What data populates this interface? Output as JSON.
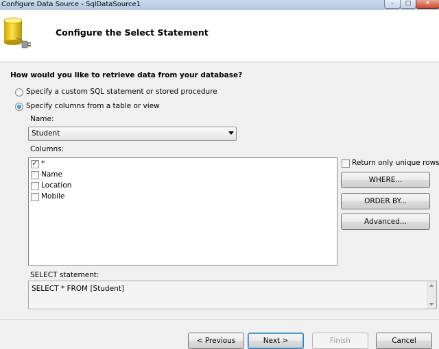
{
  "window": {
    "title": "Configure Data Source - SqlDataSource1",
    "min_glyph": "–",
    "max_glyph": "□",
    "close_glyph": "✕"
  },
  "header": {
    "title": "Configure the Select Statement",
    "icon": "database-plug-icon"
  },
  "question": "How would you like to retrieve data from your database?",
  "options": [
    {
      "label": "Specify a custom SQL statement or stored procedure",
      "selected": false
    },
    {
      "label": "Specify columns from a table or view",
      "selected": true
    }
  ],
  "name_field": {
    "label": "Name:",
    "value": "Student"
  },
  "columns": {
    "label": "Columns:",
    "items": [
      {
        "label": "*",
        "checked": true
      },
      {
        "label": "Name",
        "checked": false
      },
      {
        "label": "Location",
        "checked": false
      },
      {
        "label": "Mobile",
        "checked": false
      }
    ]
  },
  "unique_rows": {
    "label": "Return only unique rows",
    "checked": false
  },
  "side_buttons": {
    "where": "WHERE...",
    "order_by": "ORDER BY...",
    "advanced": "Advanced..."
  },
  "select_statement": {
    "label": "SELECT statement:",
    "value": "SELECT * FROM [Student]"
  },
  "footer": {
    "previous": "< Previous",
    "next": "Next >",
    "finish": "Finish",
    "cancel": "Cancel"
  },
  "colors": {
    "titlebar": "#b3c9e3",
    "header_bg": "#ffffff",
    "dialog_bg": "#f0f0f0",
    "default_button": "#3c7fb1"
  }
}
